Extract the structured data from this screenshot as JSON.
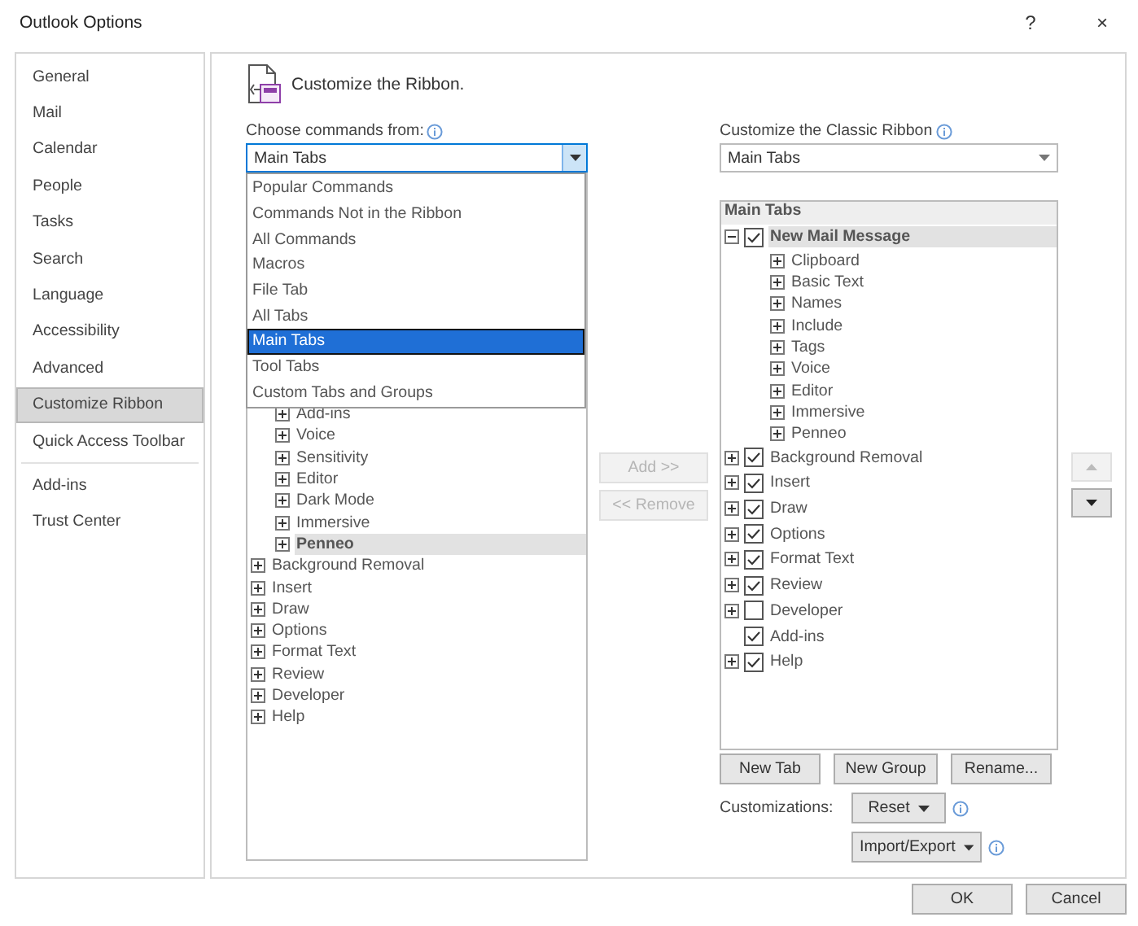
{
  "window": {
    "title": "Outlook Options",
    "help": "?",
    "close": "×"
  },
  "sidebar": {
    "groups": [
      [
        {
          "label": "General",
          "selected": false
        },
        {
          "label": "Mail",
          "selected": false
        },
        {
          "label": "Calendar",
          "selected": false
        },
        {
          "label": "People",
          "selected": false
        },
        {
          "label": "Tasks",
          "selected": false
        },
        {
          "label": "Search",
          "selected": false
        },
        {
          "label": "Language",
          "selected": false
        },
        {
          "label": "Accessibility",
          "selected": false
        },
        {
          "label": "Advanced",
          "selected": false
        },
        {
          "label": "Customize Ribbon",
          "selected": true
        },
        {
          "label": "Quick Access Toolbar",
          "selected": false
        }
      ],
      [
        {
          "label": "Add-ins",
          "selected": false
        },
        {
          "label": "Trust Center",
          "selected": false
        }
      ]
    ]
  },
  "header": {
    "title": "Customize the Ribbon."
  },
  "left": {
    "label": "Choose commands from:",
    "dropdown": {
      "value": "Main Tabs",
      "expanded": true,
      "options": [
        {
          "label": "Popular Commands",
          "selected": false
        },
        {
          "label": "Commands Not in the Ribbon",
          "selected": false
        },
        {
          "label": "All Commands",
          "selected": false
        },
        {
          "label": "Macros",
          "selected": false
        },
        {
          "label": "File Tab",
          "selected": false
        },
        {
          "label": "All Tabs",
          "selected": false
        },
        {
          "label": "Main Tabs",
          "selected": true
        },
        {
          "label": "Tool Tabs",
          "selected": false
        },
        {
          "label": "Custom Tabs and Groups",
          "selected": false
        }
      ]
    },
    "tree": {
      "continued_children": [
        {
          "label": "Add-ins",
          "selected": false
        },
        {
          "label": "Voice",
          "selected": false
        },
        {
          "label": "Sensitivity",
          "selected": false
        },
        {
          "label": "Editor",
          "selected": false
        },
        {
          "label": "Dark Mode",
          "selected": false
        },
        {
          "label": "Immersive",
          "selected": false
        },
        {
          "label": "Penneo",
          "selected": true
        }
      ],
      "items": [
        {
          "label": "Background Removal",
          "selected": false
        },
        {
          "label": "Insert",
          "selected": false
        },
        {
          "label": "Draw",
          "selected": false
        },
        {
          "label": "Options",
          "selected": false
        },
        {
          "label": "Format Text",
          "selected": false
        },
        {
          "label": "Review",
          "selected": false
        },
        {
          "label": "Developer",
          "selected": false
        },
        {
          "label": "Help",
          "selected": false
        }
      ]
    }
  },
  "transfer_buttons": [
    {
      "label": "Add >>",
      "disabled": true
    },
    {
      "label": "<< Remove",
      "disabled": true
    }
  ],
  "right": {
    "label": "Customize the Classic Ribbon",
    "dropdown": {
      "value": "Main Tabs"
    },
    "tree": {
      "header": "Main Tabs",
      "items": [
        {
          "label": "New Mail Message",
          "checked": true,
          "expandable": true,
          "expanded": true,
          "selected": true,
          "children": [
            {
              "label": "Clipboard"
            },
            {
              "label": "Basic Text"
            },
            {
              "label": "Names"
            },
            {
              "label": "Include"
            },
            {
              "label": "Tags"
            },
            {
              "label": "Voice"
            },
            {
              "label": "Editor"
            },
            {
              "label": "Immersive"
            },
            {
              "label": "Penneo"
            }
          ]
        },
        {
          "label": "Background Removal",
          "checked": true,
          "expandable": true,
          "expanded": false,
          "selected": false
        },
        {
          "label": "Insert",
          "checked": true,
          "expandable": true,
          "expanded": false,
          "selected": false
        },
        {
          "label": "Draw",
          "checked": true,
          "expandable": true,
          "expanded": false,
          "selected": false
        },
        {
          "label": "Options",
          "checked": true,
          "expandable": true,
          "expanded": false,
          "selected": false
        },
        {
          "label": "Format Text",
          "checked": true,
          "expandable": true,
          "expanded": false,
          "selected": false
        },
        {
          "label": "Review",
          "checked": true,
          "expandable": true,
          "expanded": false,
          "selected": false
        },
        {
          "label": "Developer",
          "checked": false,
          "expandable": true,
          "expanded": false,
          "selected": false
        },
        {
          "label": "Add-ins",
          "checked": true,
          "expandable": false,
          "selected": false
        },
        {
          "label": "Help",
          "checked": true,
          "expandable": true,
          "expanded": false,
          "selected": false
        }
      ]
    },
    "buttons": [
      "New Tab",
      "New Group",
      "Rename..."
    ],
    "customizations_label": "Customizations:",
    "menu_buttons": [
      "Reset",
      "Import/Export"
    ]
  },
  "move_buttons": [
    {
      "kind": "up",
      "disabled": true
    },
    {
      "kind": "down",
      "disabled": false
    }
  ],
  "footer_buttons": [
    "OK",
    "Cancel"
  ]
}
